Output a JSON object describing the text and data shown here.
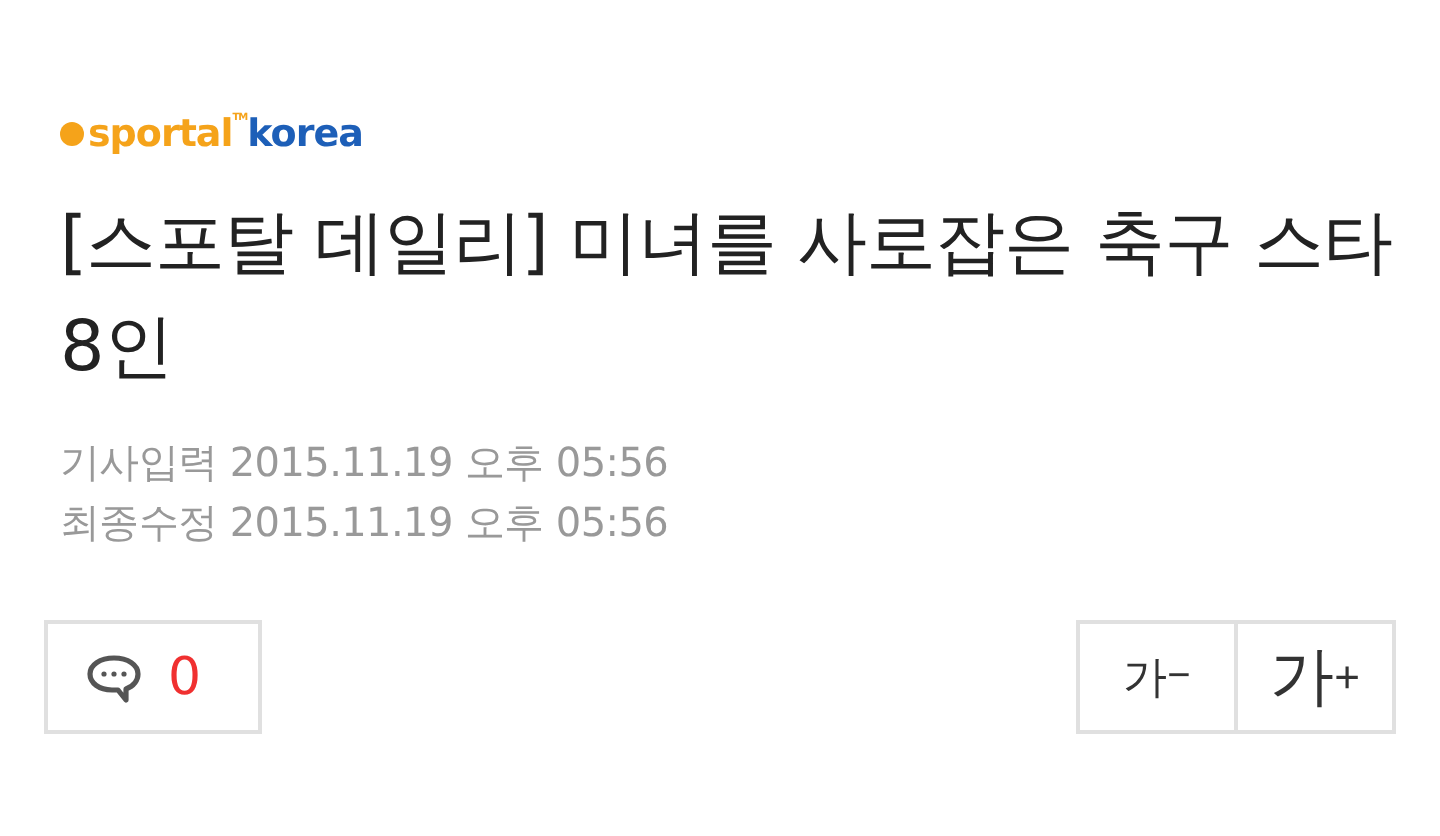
{
  "logo": {
    "part_1": "sportal",
    "mark": "TM",
    "part_2": "korea"
  },
  "headline": "[스포탈 데일리] 미녀를 사로잡은 축구 스타 8인",
  "dates": [
    {
      "label": "기사입력",
      "value": "2015.11.19 오후 05:56"
    },
    {
      "label": "최종수정",
      "value": "2015.11.19 오후 05:56"
    }
  ],
  "comments": {
    "count": "0"
  },
  "font_buttons": [
    {
      "kind": "smaller",
      "glyph": "가",
      "sign": "−"
    },
    {
      "kind": "larger",
      "glyph": "가",
      "sign": "+"
    }
  ]
}
